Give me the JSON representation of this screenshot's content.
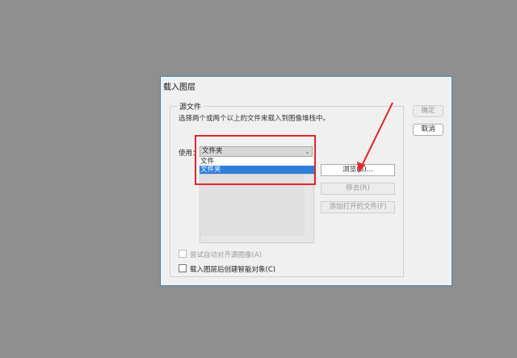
{
  "dialog": {
    "title": "载入图层",
    "group_label": "源文件",
    "description": "选择两个或两个以上的文件来载入到图像堆栈中。",
    "use_label": "使用：",
    "select_value": "文件夹",
    "options": [
      "文件",
      "文件夹"
    ],
    "buttons": {
      "browse": "浏览(B)...",
      "remove": "移去(R)",
      "add_open": "添加打开的文件(F)",
      "ok": "确定",
      "cancel": "取消"
    },
    "checkboxes": {
      "auto_align": "尝试自动对齐源图像(A)",
      "create_smart": "载入图层后创建智能对象(C)"
    }
  },
  "colors": {
    "highlight": "#e3282c",
    "selection": "#2d7fd8",
    "dialog_border": "#3c7fb1"
  },
  "icons": {
    "dropdown": "chevron-down-icon"
  }
}
